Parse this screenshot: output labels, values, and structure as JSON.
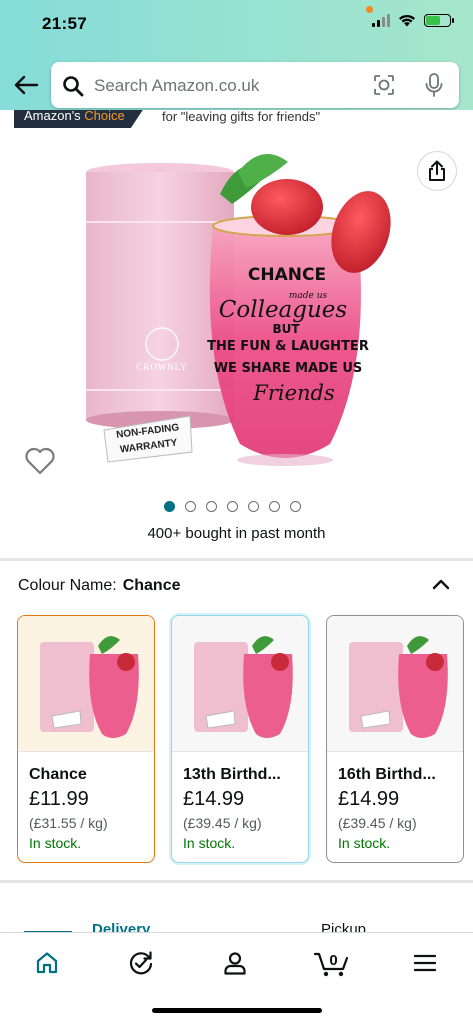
{
  "status_bar": {
    "time": "21:57"
  },
  "header": {
    "search_placeholder": "Search Amazon.co.uk"
  },
  "badge": {
    "prefix": "Amazon's",
    "highlight": "Choice",
    "for_text": "for \"leaving gifts for friends\""
  },
  "product_image": {
    "brand": "CROWNLY",
    "warranty": [
      "NON-FADING",
      "WARRANTY"
    ],
    "glass_text": [
      "CHANCE",
      "made us",
      "Colleagues",
      "BUT",
      "THE FUN & LAUGHTER",
      "WE SHARE MADE US",
      "Friends"
    ],
    "image_count": 7,
    "active_index": 0
  },
  "bought_text": "400+ bought in past month",
  "colour": {
    "label": "Colour Name:",
    "value": "Chance",
    "options": [
      {
        "name": "Chance",
        "price": "£11.99",
        "unit_price": "(£31.55 / kg)",
        "stock": "In stock."
      },
      {
        "name": "13th Birthd...",
        "price": "£14.99",
        "unit_price": "(£39.45 / kg)",
        "stock": "In stock."
      },
      {
        "name": "16th Birthd...",
        "price": "£14.99",
        "unit_price": "(£39.45 / kg)",
        "stock": "In stock."
      }
    ]
  },
  "tabs": {
    "delivery": "Delivery",
    "pickup": "Pickup"
  },
  "nav": {
    "cart_count": "0"
  },
  "colors": {
    "accent_teal": "#007185",
    "selected_orange": "#e47911",
    "in_stock_green": "#007600",
    "header_gradient_start": "#85dcd8",
    "header_gradient_end": "#a6e6cc"
  }
}
